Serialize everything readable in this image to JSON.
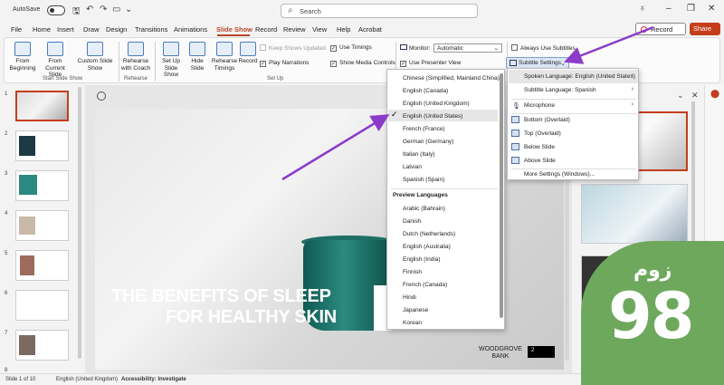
{
  "titlebar": {
    "autosave_label": "AutoSave",
    "search_placeholder": "Search"
  },
  "menu": {
    "tabs": [
      "File",
      "Home",
      "Insert",
      "Draw",
      "Design",
      "Transitions",
      "Animations",
      "Slide Show",
      "Record",
      "Review",
      "View",
      "Help",
      "Acrobat"
    ],
    "active": "Slide Show",
    "record_label": "Record",
    "share_label": "Share"
  },
  "ribbon": {
    "start_slide_show": {
      "from_beginning": "From Beginning",
      "from_current": "From Current Slide",
      "custom": "Custom Slide Show",
      "group": "Start Slide Show"
    },
    "rehearse": {
      "rehearse_coach": "Rehearse with Coach",
      "group": "Rehearse"
    },
    "setup": {
      "set_up": "Set Up Slide Show",
      "hide": "Hide Slide",
      "timings": "Rehearse Timings",
      "record": "Record",
      "keep_shows_updated": "Keep Shows Updated",
      "play_narrations": "Play Narrations",
      "use_timings": "Use Timings",
      "show_media_controls": "Show Media Controls",
      "group": "Set Up"
    },
    "monitors": {
      "monitor_label": "Monitor:",
      "monitor_value": "Automatic",
      "use_presenter_view": "Use Presenter View"
    },
    "captions": {
      "always_use_subtitles": "Always Use Subtitles",
      "subtitle_settings": "Subtitle Settings"
    }
  },
  "language_menu": {
    "items": [
      "Chinese (Simplified, Mainland China)",
      "English (Canada)",
      "English (United Kingdom)",
      "English (United States)",
      "French (France)",
      "German (Germany)",
      "Italian (Italy)",
      "Latvian",
      "Spanish (Spain)"
    ],
    "checked": "English (United States)",
    "preview_header": "Preview Languages",
    "preview_items": [
      "Arabic (Bahrain)",
      "Danish",
      "Dutch (Netherlands)",
      "English (Australia)",
      "English (India)",
      "Finnish",
      "French (Canada)",
      "Hindi",
      "Japanese",
      "Korean"
    ]
  },
  "subtitle_menu": {
    "spoken_language": "Spoken Language: English (United States)",
    "subtitle_language": "Subtitle Language: Spanish",
    "microphone": "Microphone",
    "bottom_overlaid": "Bottom (Overlaid)",
    "top_overlaid": "Top (Overlaid)",
    "below_slide": "Below Slide",
    "above_slide": "Above Slide",
    "more_settings": "More Settings (Windows)..."
  },
  "slide": {
    "title_line1": "THE BENEFITS OF SLEEP",
    "title_line2": "FOR HEALTHY SKIN",
    "brand_line1": "WOODGROVE",
    "brand_line2": "BANK",
    "page_num": "2"
  },
  "thumbnails": {
    "numbers": [
      "1",
      "2",
      "3",
      "4",
      "5",
      "6",
      "7",
      "8"
    ]
  },
  "statusbar": {
    "slide_of": "Slide 1 of 10",
    "language": "English (United Kingdom)",
    "accessibility": "Accessibility: Investigate"
  },
  "watermark": {
    "number": "98",
    "word": "زوم"
  },
  "colors": {
    "accent": "#b7472a",
    "share": "#c43e1c",
    "arrow": "#8a3cc9",
    "watermark": "#6ea85d"
  }
}
